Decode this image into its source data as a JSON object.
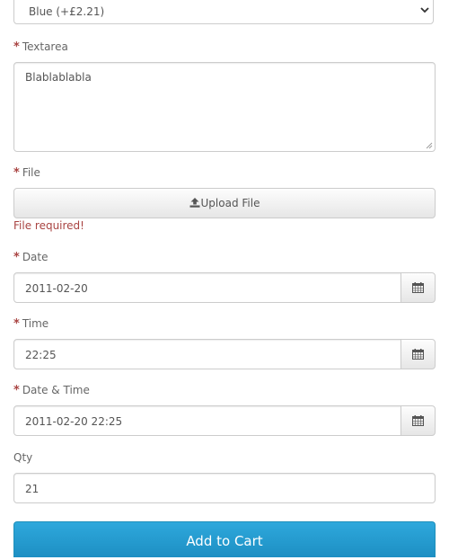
{
  "option_select": {
    "selected": "Blue (+£2.21)"
  },
  "textarea": {
    "label": "Textarea",
    "value": "Blablablabla"
  },
  "file": {
    "label": "File",
    "button_label": "Upload File",
    "error": "File required!"
  },
  "date": {
    "label": "Date",
    "value": "2011-02-20"
  },
  "time": {
    "label": "Time",
    "value": "22:25"
  },
  "datetime": {
    "label": "Date & Time",
    "value": "2011-02-20 22:25"
  },
  "qty": {
    "label": "Qty",
    "value": "21"
  },
  "add_to_cart": {
    "label": "Add to Cart",
    "color": "#23a1d1"
  },
  "required_marker": "*",
  "icons": {
    "select_arrow": "chevron-down-icon",
    "upload": "upload-icon",
    "calendar": "calendar-icon"
  },
  "colors": {
    "required": "#a94442",
    "error": "#a94442",
    "button_primary": "#23a1d1"
  }
}
